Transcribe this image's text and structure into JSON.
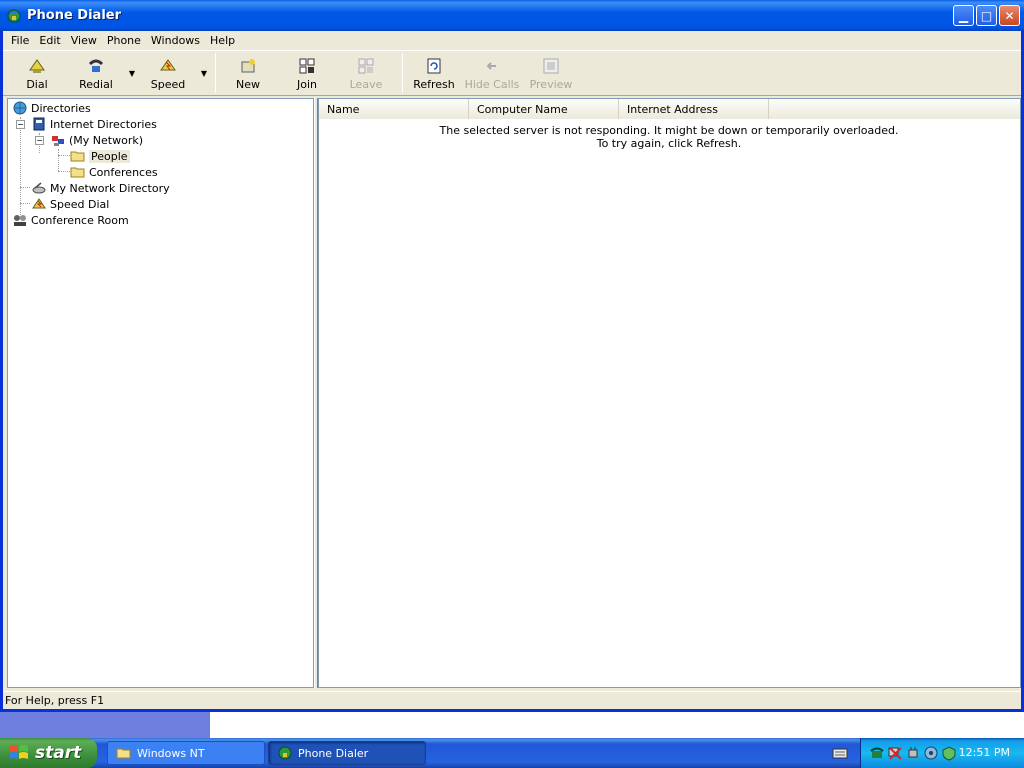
{
  "window": {
    "title": "Phone Dialer",
    "controls": [
      "minimize",
      "maximize",
      "close"
    ]
  },
  "menu": [
    "File",
    "Edit",
    "View",
    "Phone",
    "Windows",
    "Help"
  ],
  "toolbar": {
    "dial": "Dial",
    "redial": "Redial",
    "speed": "Speed",
    "new": "New",
    "join": "Join",
    "leave": "Leave",
    "refresh": "Refresh",
    "hide_calls": "Hide Calls",
    "preview": "Preview"
  },
  "tree": {
    "directories": "Directories",
    "internet_directories": "Internet Directories",
    "my_network": "(My Network)",
    "people": "People",
    "conferences": "Conferences",
    "my_network_directory": "My Network Directory",
    "speed_dial": "Speed Dial",
    "conference_room": "Conference Room"
  },
  "list": {
    "columns": [
      "Name",
      "Computer Name",
      "Internet Address"
    ],
    "message_line1": "The selected server is not responding. It might be down or temporarily overloaded.",
    "message_line2": "To try again, click Refresh."
  },
  "status": "For Help, press F1",
  "taskbar": {
    "start": "start",
    "tasks": [
      "Windows NT",
      "Phone Dialer"
    ],
    "clock": "12:51 PM"
  },
  "colors": {
    "titlebar": "#0054e3",
    "taskbar": "#2663e0",
    "start": "#3c8f3c",
    "window_face": "#ece9d8"
  }
}
